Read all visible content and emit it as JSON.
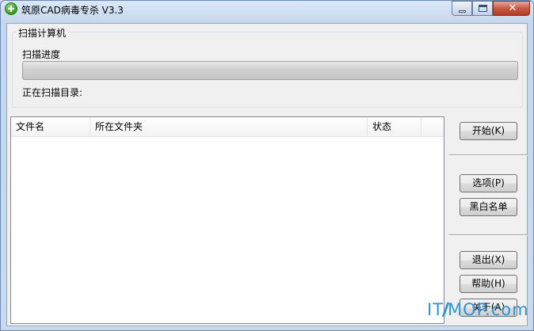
{
  "window": {
    "title": "筑原CAD病毒专杀  V3.3",
    "close_glyph": "✕"
  },
  "scan_group": {
    "title": "扫描计算机",
    "progress_label": "扫描进度",
    "progress_fraction": 0,
    "current_dir_label": "正在扫描目录:",
    "current_dir_value": ""
  },
  "results_table": {
    "columns": [
      "文件名",
      "所在文件夹",
      "状态"
    ],
    "rows": []
  },
  "buttons": {
    "start": "开始(K)",
    "options": "选项(P)",
    "blackwhite_list": "黑白名单",
    "exit": "退出(X)",
    "help": "帮助(H)",
    "about": "关于(A)"
  },
  "watermark": {
    "text_left": "IT",
    "text_right": "MOP.com"
  },
  "colors": {
    "title_accent": "#c4d7ee",
    "close_button": "#c95a43",
    "watermark": "#2c95d8"
  }
}
